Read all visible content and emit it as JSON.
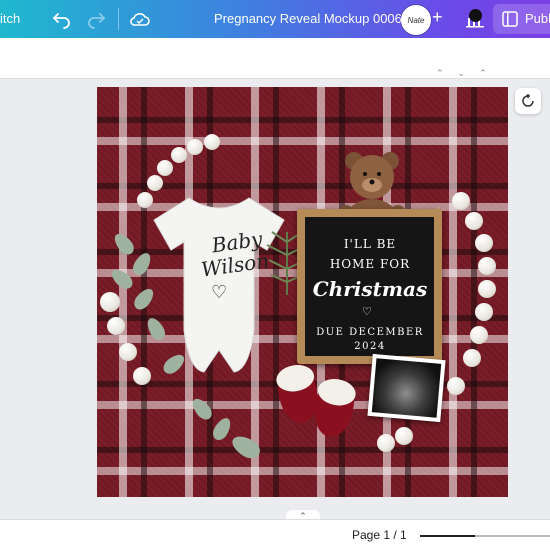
{
  "topbar": {
    "switch_label": "itch",
    "title": "Pregnancy Reveal Mockup 0006",
    "avatar_text": "Nate",
    "plus_label": "+",
    "publish_label": "Publi"
  },
  "design": {
    "onesie_line1": "Baby",
    "onesie_line2": "Wilson",
    "heart": "♡",
    "board_line1": "I'LL BE",
    "board_line2": "HOME FOR",
    "board_line3": "Christmas",
    "board_line4": "DUE DECEMBER",
    "board_line5": "2024"
  },
  "bottombar": {
    "pager": "Page 1 / 1",
    "zoom_fraction": 0.42
  },
  "icons": {
    "undo": "undo-icon",
    "redo": "redo-icon",
    "cloud": "cloud-sync-icon",
    "analytics": "bar-chart-icon",
    "publish": "publish-icon",
    "refresh": "refresh-comment-icon",
    "collapse": "chevron-up-icon"
  },
  "colors": {
    "topbar_start": "#1fb8cf",
    "topbar_end": "#7a3fe6",
    "plaid_red": "#7a1d28",
    "board_frame": "#b58a57"
  }
}
